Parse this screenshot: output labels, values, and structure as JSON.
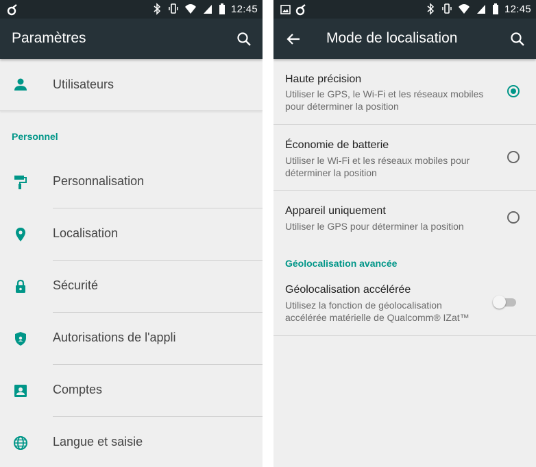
{
  "status_bar": {
    "time": "12:45"
  },
  "left_screen": {
    "title": "Paramètres",
    "users_item": {
      "label": "Utilisateurs",
      "icon": "person-icon"
    },
    "section_header": "Personnel",
    "items": [
      {
        "label": "Personnalisation",
        "icon": "paint-roller-icon"
      },
      {
        "label": "Localisation",
        "icon": "location-pin-icon"
      },
      {
        "label": "Sécurité",
        "icon": "lock-icon"
      },
      {
        "label": "Autorisations de l'appli",
        "icon": "shield-icon"
      },
      {
        "label": "Comptes",
        "icon": "account-box-icon"
      },
      {
        "label": "Langue et saisie",
        "icon": "globe-icon"
      }
    ]
  },
  "right_screen": {
    "title": "Mode de localisation",
    "options": [
      {
        "title": "Haute précision",
        "desc_line1": "Utiliser le GPS, le Wi-Fi et les réseaux mobiles",
        "desc_line2": "pour déterminer la position",
        "selected": true
      },
      {
        "title": "Économie de batterie",
        "desc_line1": "Utiliser le Wi-Fi et les réseaux mobiles pour",
        "desc_line2": "déterminer la position",
        "selected": false
      },
      {
        "title": "Appareil uniquement",
        "desc_line1": "Utiliser le GPS pour déterminer la position",
        "desc_line2": "",
        "selected": false
      }
    ],
    "advanced_header": "Géolocalisation avancée",
    "advanced_item": {
      "title": "Géolocalisation accélérée",
      "desc_line1": "Utilisez la fonction de géolocalisation",
      "desc_line2": "accélérée matérielle de Qualcomm® IZat™",
      "enabled": false
    }
  },
  "colors": {
    "accent": "#009688",
    "toolbar": "#263238",
    "statusbar": "#1f282c",
    "background": "#efefef"
  }
}
